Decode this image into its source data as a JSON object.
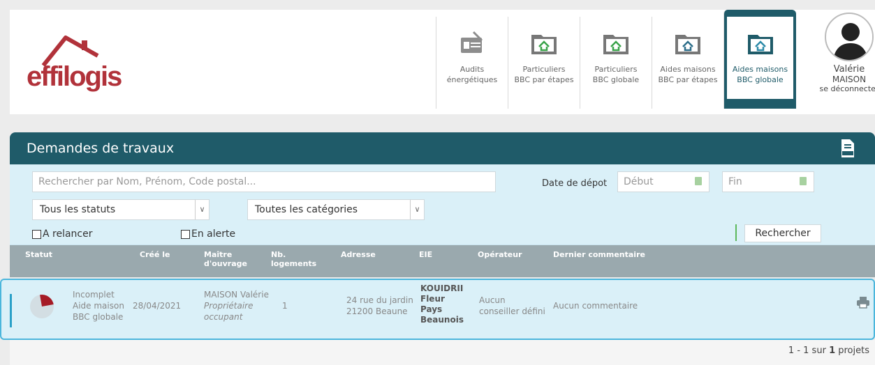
{
  "brand": {
    "logo_text": "effilogis",
    "logo_color": "#b1323a"
  },
  "nav": [
    {
      "label": "Audits\nénergétiques",
      "icon": "audit-document-icon",
      "active": false
    },
    {
      "label": "Particuliers\nBBC par étapes",
      "icon": "folder-house-icon",
      "active": false
    },
    {
      "label": "Particuliers\nBBC globale",
      "icon": "folder-house-icon",
      "active": false
    },
    {
      "label": "Aides maisons\nBBC par étapes",
      "icon": "folder-house-icon",
      "active": false
    },
    {
      "label": "Aides maisons\nBBC globale",
      "icon": "folder-house-icon",
      "active": true
    }
  ],
  "user": {
    "first_name": "Valérie",
    "last_name": "MAISON",
    "logout": "se déconnecter"
  },
  "panel": {
    "title": "Demandes de travaux",
    "export_icon": "xlsx-export-icon"
  },
  "filters": {
    "search_placeholder": "Rechercher par Nom, Prénom, Code postal...",
    "date_label": "Date de dépot",
    "start_placeholder": "Début",
    "end_placeholder": "Fin",
    "status_select": "Tous les statuts",
    "category_select": "Toutes les catégories",
    "relancer": "A relancer",
    "alerte": "En alerte",
    "search_button": "Rechercher"
  },
  "table": {
    "headers": [
      "Statut",
      "Créé le",
      "Maître\nd'ouvrage",
      "Nb.\nlogements",
      "Adresse",
      "EIE",
      "Opérateur",
      "Dernier commentaire"
    ],
    "rows": [
      {
        "status_lines": [
          "Incomplet",
          "Aide maison",
          "BBC globale"
        ],
        "created": "28/04/2021",
        "owner_name": "MAISON Valérie",
        "owner_role_lines": [
          "Propriétaire",
          "occupant"
        ],
        "nb_logements": "1",
        "address_lines": [
          "24 rue du jardin",
          "21200 Beaune"
        ],
        "eie_lines": [
          "KOUIDRII",
          "Fleur",
          "Pays",
          "Beaunois"
        ],
        "operator_lines": [
          "Aucun",
          "conseiller défini"
        ],
        "comment": "Aucun commentaire"
      }
    ]
  },
  "pagination": {
    "prefix": "1 - 1 sur",
    "total": "1",
    "suffix": "projets"
  },
  "colors": {
    "primary": "#1f5b69",
    "filter_bg": "#daf0f8",
    "header_row": "#9aa9ae",
    "highlight_border": "#4bb6dc",
    "status_red": "#a51b26"
  }
}
